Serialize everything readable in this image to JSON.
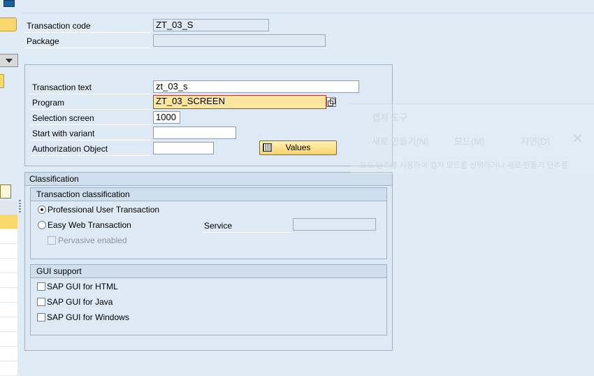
{
  "header": {
    "transaction_code_label": "Transaction code",
    "transaction_code_value": "ZT_03_S",
    "package_label": "Package",
    "package_value": ""
  },
  "detail": {
    "transaction_text_label": "Transaction text",
    "transaction_text_value": "zt_03_s",
    "program_label": "Program",
    "program_value": "ZT_03_SCREEN",
    "selection_screen_label": "Selection screen",
    "selection_screen_value": "1000",
    "start_variant_label": "Start with variant",
    "start_variant_value": "",
    "auth_object_label": "Authorization Object",
    "auth_object_value": "",
    "values_button_label": "Values"
  },
  "classification": {
    "title": "Classification",
    "transaction_classification": {
      "title": "Transaction classification",
      "professional_label": "Professional User Transaction",
      "easy_web_label": "Easy Web Transaction",
      "service_label": "Service",
      "service_value": "",
      "pervasive_label": "Pervasive enabled",
      "selected": "professional"
    },
    "gui_support": {
      "title": "GUI support",
      "html_label": "SAP GUI for HTML",
      "java_label": "SAP GUI for Java",
      "windows_label": "SAP GUI for Windows"
    }
  },
  "ghost_overlay": {
    "title": "캡처 도구",
    "new_label": "새로 만들기(N)",
    "mode_label": "모드(M)",
    "delay_label": "지연(D)",
    "hint_text": "모드 단추를 사용하여 캡처 모드를 선택하거나 새로 만들기 단추를"
  },
  "icons": [
    "info-icon",
    "dropdown-arrow-icon",
    "document-icon",
    "value-help-icon",
    "table-icon",
    "close-icon"
  ],
  "colors": {
    "background": "#dfebf5",
    "required_field": "#fbe59f",
    "button": "#fad46c"
  }
}
